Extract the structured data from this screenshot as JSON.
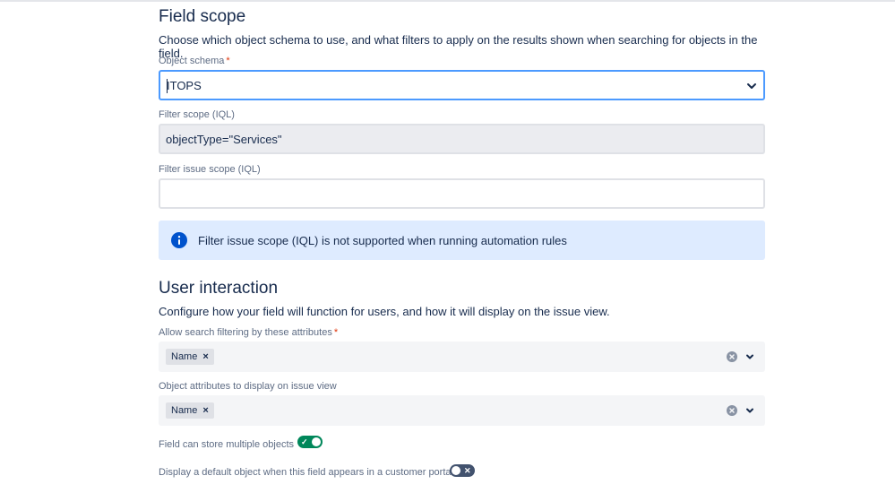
{
  "field_scope": {
    "heading": "Field scope",
    "description": "Choose which object schema to use, and what filters to apply on the results shown when searching for objects in the field.",
    "object_schema": {
      "label": "Object schema",
      "required_mark": "*",
      "value": "ITOPS"
    },
    "filter_scope": {
      "label": "Filter scope (IQL)",
      "value": "objectType=\"Services\""
    },
    "filter_issue_scope": {
      "label": "Filter issue scope (IQL)",
      "value": ""
    },
    "info_message": "Filter issue scope (IQL) is not supported when running automation rules"
  },
  "user_interaction": {
    "heading": "User interaction",
    "description": "Configure how your field will function for users, and how it will display on the issue view.",
    "search_attributes": {
      "label": "Allow search filtering by these attributes",
      "required_mark": "*",
      "tags": [
        "Name"
      ]
    },
    "display_attributes": {
      "label": "Object attributes to display on issue view",
      "tags": [
        "Name"
      ]
    },
    "multiple_objects": {
      "label": "Field can store multiple objects",
      "enabled": true
    },
    "default_object": {
      "label": "Display a default object when this field appears in a customer portal",
      "enabled": false
    }
  },
  "colors": {
    "toggle_on": "#00875a",
    "toggle_off": "#42526e",
    "focus_border": "#4c9aff",
    "info_bg": "#deebff",
    "info_icon": "#0052cc"
  },
  "icons": {
    "info": "info-icon",
    "chevron": "chevron-down-icon",
    "clear": "clear-icon",
    "remove": "remove-tag-icon",
    "check": "check-icon",
    "cross": "cross-icon"
  }
}
